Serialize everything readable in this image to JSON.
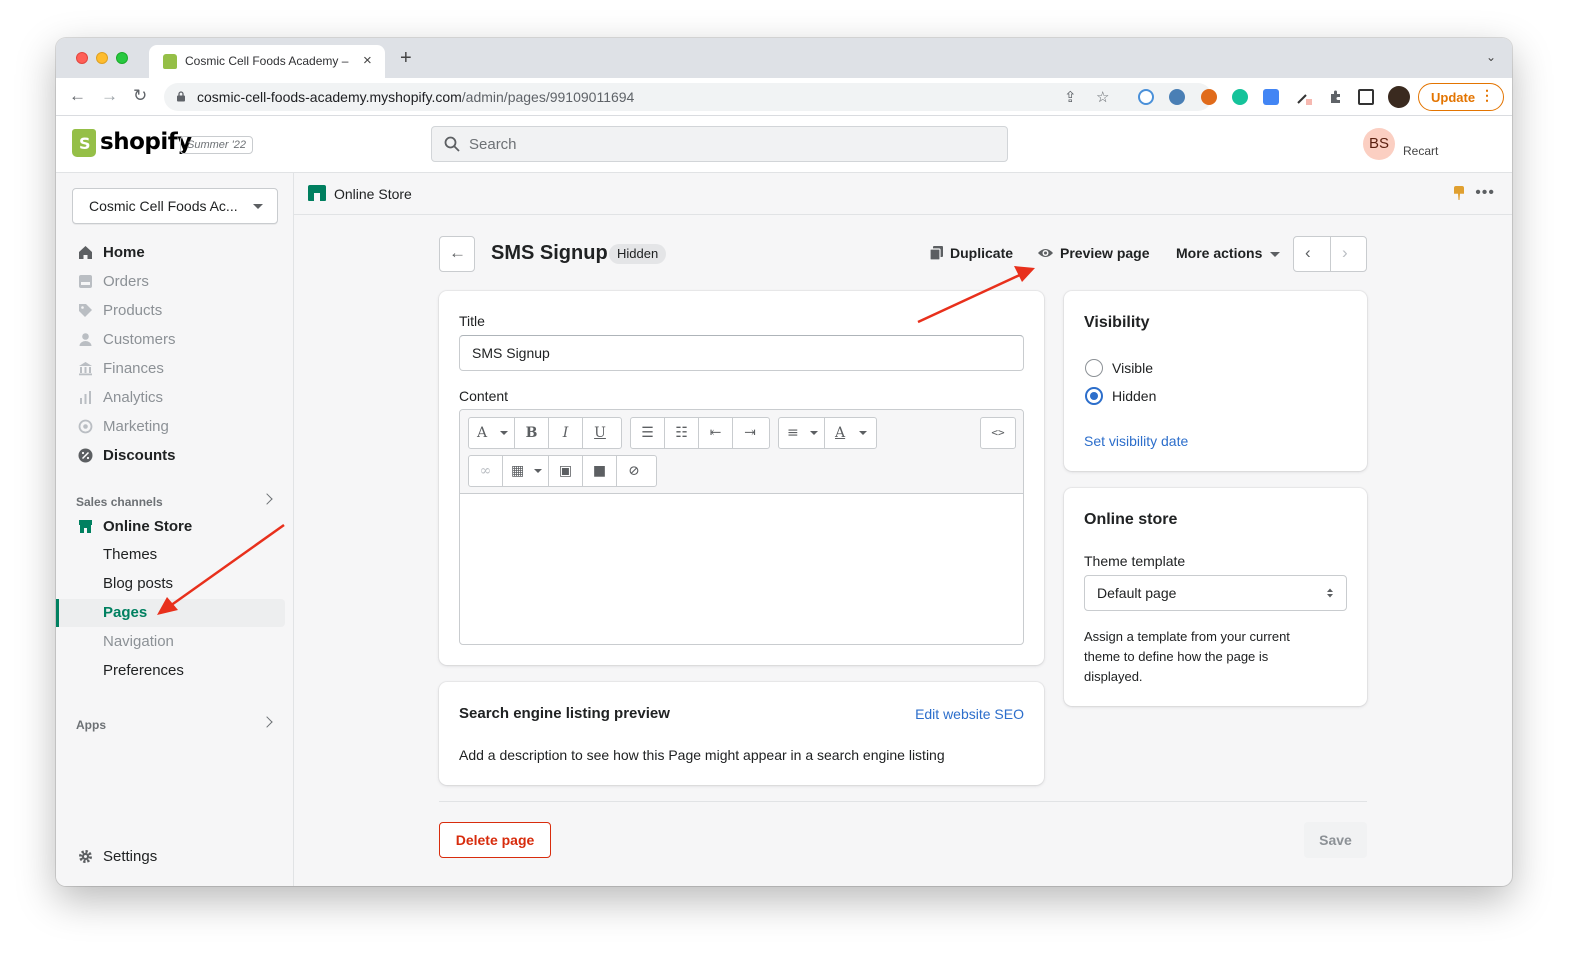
{
  "browser": {
    "tab_title": "Cosmic Cell Foods Academy –",
    "url_host": "cosmic-cell-foods-academy.myshopify.com",
    "url_path": "/admin/pages/99109011694",
    "update_label": "Update",
    "update_menu": "⋮"
  },
  "topbar": {
    "logo_text": "shopify",
    "edition_badge": "Summer '22",
    "search_placeholder": "Search",
    "user_initials": "BS",
    "user_name": "Recart"
  },
  "sidebar": {
    "store_name": "Cosmic Cell Foods Ac...",
    "items": [
      {
        "label": "Home",
        "icon": "home-icon"
      },
      {
        "label": "Orders",
        "icon": "orders-icon"
      },
      {
        "label": "Products",
        "icon": "tag-icon"
      },
      {
        "label": "Customers",
        "icon": "person-icon"
      },
      {
        "label": "Finances",
        "icon": "bank-icon"
      },
      {
        "label": "Analytics",
        "icon": "bar-chart-icon"
      },
      {
        "label": "Marketing",
        "icon": "target-icon"
      },
      {
        "label": "Discounts",
        "icon": "discount-icon"
      }
    ],
    "sales_channels_label": "Sales channels",
    "online_store_label": "Online Store",
    "sub_items": [
      "Themes",
      "Blog posts",
      "Pages",
      "Navigation",
      "Preferences"
    ],
    "apps_label": "Apps",
    "settings_label": "Settings"
  },
  "breadcrumb": {
    "label": "Online Store"
  },
  "page_header": {
    "title": "SMS Signup",
    "badge": "Hidden",
    "duplicate_label": "Duplicate",
    "preview_label": "Preview page",
    "more_actions_label": "More actions"
  },
  "editor_card": {
    "title_label": "Title",
    "title_value": "SMS Signup",
    "content_label": "Content",
    "toolbar_html_label": "<>"
  },
  "seo_card": {
    "title": "Search engine listing preview",
    "edit_link": "Edit website SEO",
    "description": "Add a description to see how this Page might appear in a search engine listing"
  },
  "visibility_card": {
    "title": "Visibility",
    "option_visible": "Visible",
    "option_hidden": "Hidden",
    "selected": "Hidden",
    "set_date_link": "Set visibility date"
  },
  "online_store_card": {
    "title": "Online store",
    "template_label": "Theme template",
    "template_value": "Default page",
    "help": "Assign a template from your current theme to define how the page is displayed."
  },
  "footer": {
    "delete_label": "Delete page",
    "save_label": "Save"
  },
  "colors": {
    "accent_green": "#008060",
    "link_blue": "#2c6ecb",
    "critical_red": "#d72c0d",
    "annotation_arrow": "#e8301c"
  }
}
